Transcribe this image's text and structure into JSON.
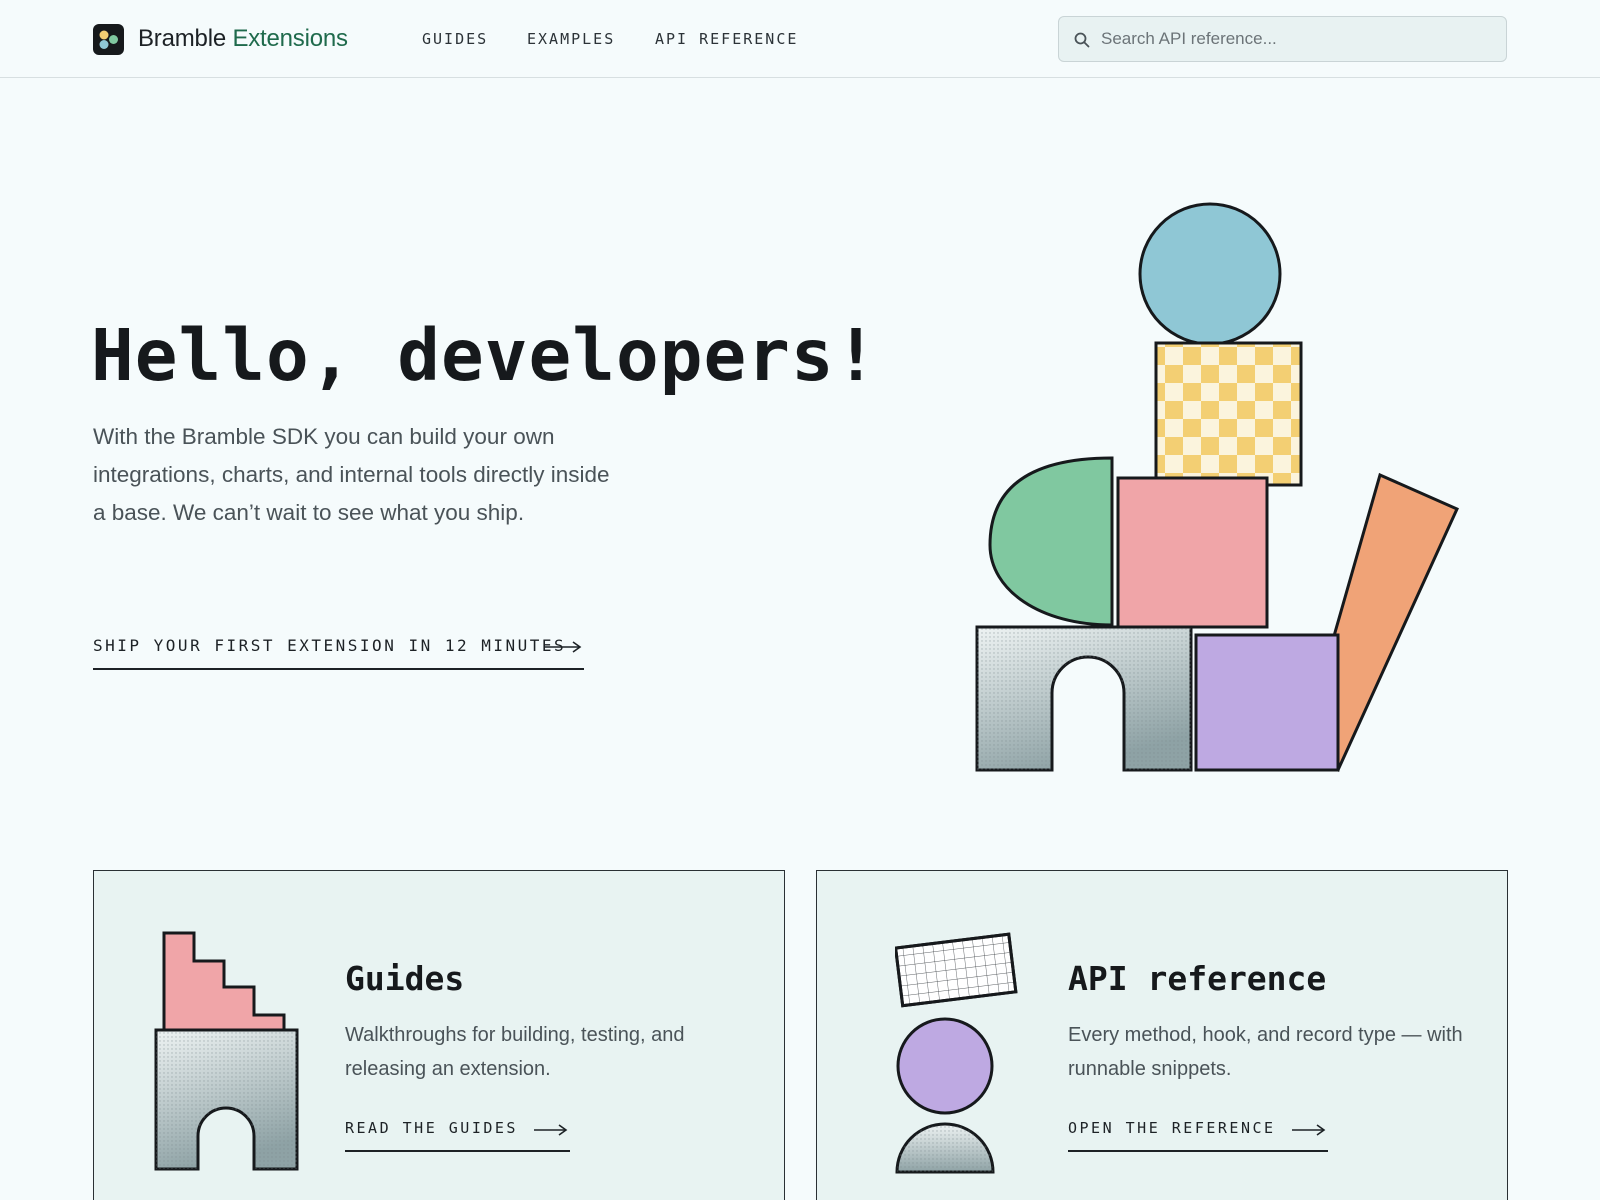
{
  "header": {
    "brand_primary": "Bramble",
    "brand_accent": "Extensions",
    "nav": [
      "GUIDES",
      "EXAMPLES",
      "API REFERENCE"
    ],
    "search_placeholder": "Search API reference..."
  },
  "hero": {
    "title": "Hello, developers!",
    "description": "With the Bramble SDK you can build your own integrations, charts, and internal tools directly inside a base. We can’t wait to see what you ship.",
    "cta": "SHIP YOUR FIRST EXTENSION IN 12 MINUTES"
  },
  "cards": [
    {
      "title": "Guides",
      "description": "Walkthroughs for building, testing, and releasing an extension.",
      "link": "READ THE GUIDES"
    },
    {
      "title": "API reference",
      "description": "Every method, hook, and record type — with runnable snippets.",
      "link": "OPEN THE REFERENCE"
    }
  ],
  "colors": {
    "brand_accent": "#1f6a4c",
    "background": "#f5fbfc",
    "card_background": "#e8f3f2",
    "blue": "#8fc7d5",
    "yellow": "#f3cf73",
    "green": "#80c8a0",
    "pink": "#f0a5a8",
    "orange": "#f0a377",
    "purple": "#bea9e2",
    "gray": "#a6b5b7"
  }
}
